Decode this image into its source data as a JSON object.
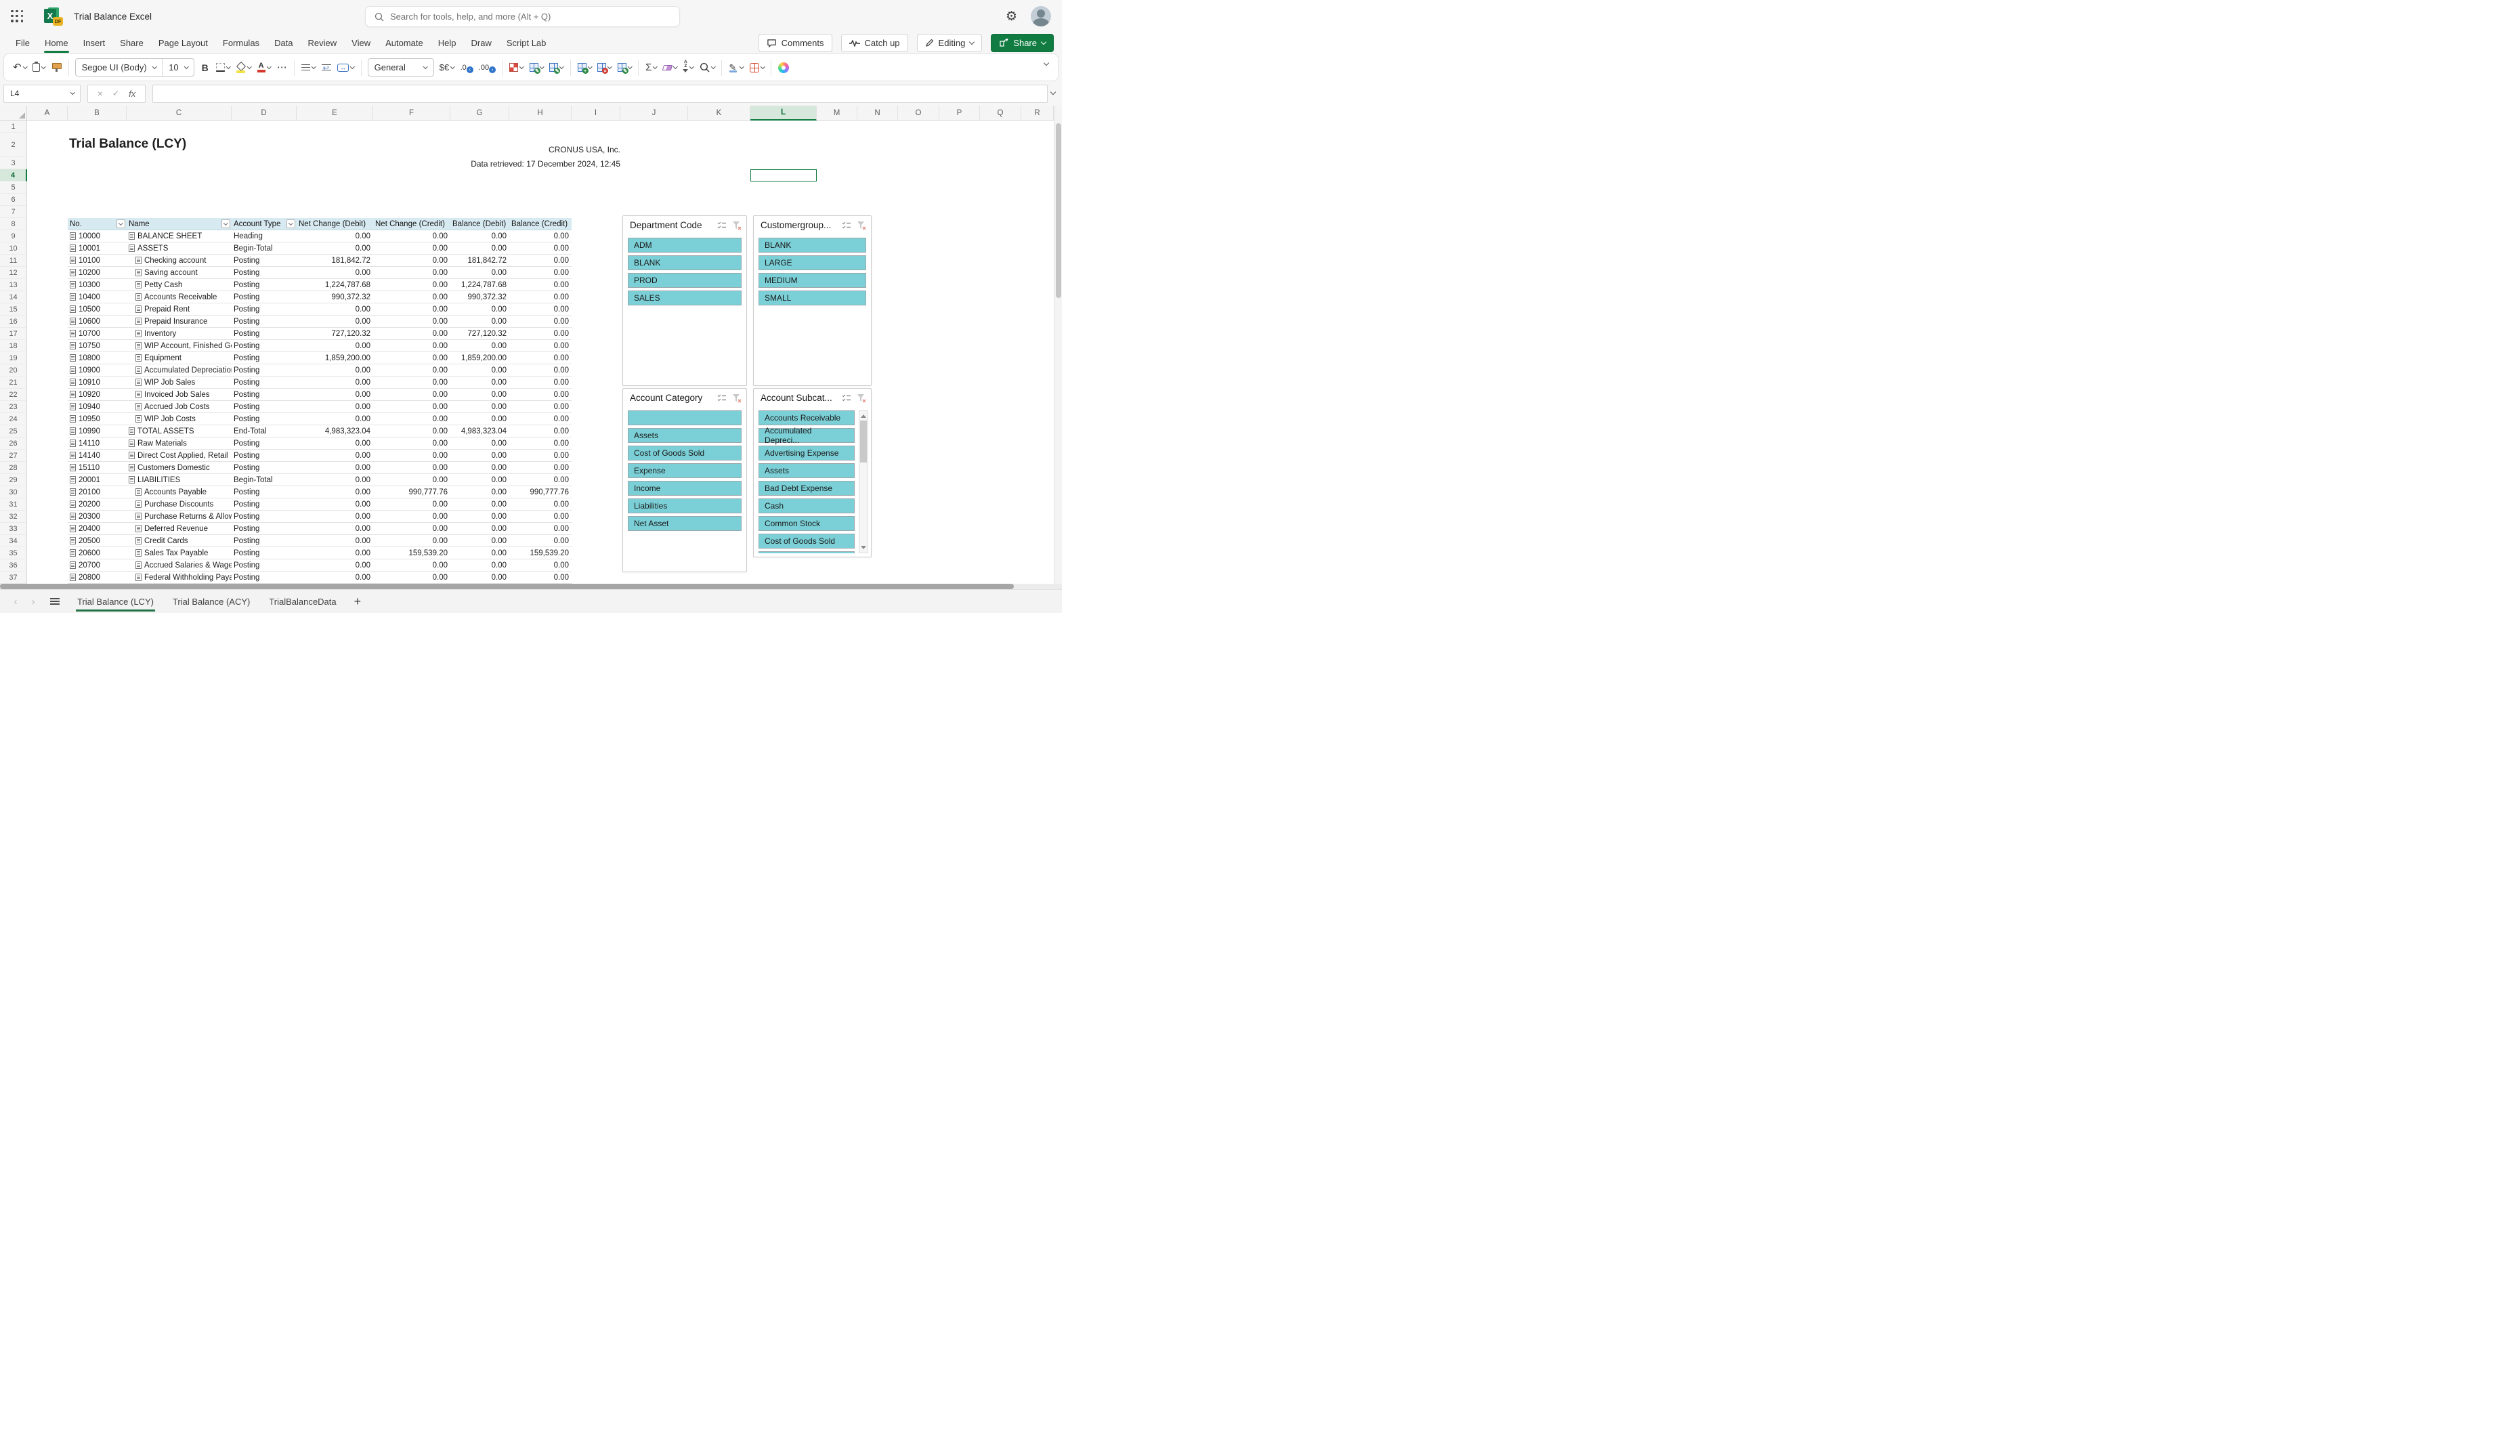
{
  "app": {
    "title": "Trial Balance Excel",
    "search_placeholder": "Search for tools, help, and more (Alt + Q)"
  },
  "ribbon": {
    "tabs": [
      "File",
      "Home",
      "Insert",
      "Share",
      "Page Layout",
      "Formulas",
      "Data",
      "Review",
      "View",
      "Automate",
      "Help",
      "Draw",
      "Script Lab"
    ],
    "active_tab": "Home",
    "comments_label": "Comments",
    "catch_up_label": "Catch up",
    "editing_label": "Editing",
    "share_label": "Share"
  },
  "toolbar": {
    "font_name": "Segoe UI (Body)",
    "font_size": "10",
    "bold_label": "B",
    "number_format": "General",
    "currency_label": "$€",
    "decrease_decimal_label": ".0",
    "increase_decimal_label": ".00",
    "autosum_label": "Σ",
    "sort_label": "AZ"
  },
  "formula_bar": {
    "name_box": "L4",
    "cancel_glyph": "×",
    "enter_glyph": "✓",
    "fx_label": "fx"
  },
  "grid": {
    "columns": [
      "A",
      "B",
      "C",
      "D",
      "E",
      "F",
      "G",
      "H",
      "I",
      "J",
      "K",
      "L",
      "M",
      "N",
      "O",
      "P",
      "Q",
      "R"
    ],
    "selected_column": "L",
    "row_count": 37,
    "selected_row": 4,
    "active_cell": "L4"
  },
  "sheet": {
    "title": "Trial Balance (LCY)",
    "company": "CRONUS USA, Inc.",
    "retrieved": "Data retrieved: 17 December 2024, 12:45",
    "table": {
      "headers": [
        "No.",
        "Name",
        "Account Type",
        "Net Change (Debit)",
        "Net Change (Credit)",
        "Balance (Debit)",
        "Balance (Credit)"
      ],
      "rows": [
        {
          "no": "10000",
          "name": "BALANCE SHEET",
          "type": "Heading",
          "ncd": "0.00",
          "ncc": "0.00",
          "bd": "0.00",
          "bc": "0.00",
          "indent": false
        },
        {
          "no": "10001",
          "name": "ASSETS",
          "type": "Begin-Total",
          "ncd": "0.00",
          "ncc": "0.00",
          "bd": "0.00",
          "bc": "0.00",
          "indent": false
        },
        {
          "no": "10100",
          "name": "Checking account",
          "type": "Posting",
          "ncd": "181,842.72",
          "ncc": "0.00",
          "bd": "181,842.72",
          "bc": "0.00",
          "indent": true
        },
        {
          "no": "10200",
          "name": "Saving account",
          "type": "Posting",
          "ncd": "0.00",
          "ncc": "0.00",
          "bd": "0.00",
          "bc": "0.00",
          "indent": true
        },
        {
          "no": "10300",
          "name": "Petty Cash",
          "type": "Posting",
          "ncd": "1,224,787.68",
          "ncc": "0.00",
          "bd": "1,224,787.68",
          "bc": "0.00",
          "indent": true
        },
        {
          "no": "10400",
          "name": "Accounts Receivable",
          "type": "Posting",
          "ncd": "990,372.32",
          "ncc": "0.00",
          "bd": "990,372.32",
          "bc": "0.00",
          "indent": true
        },
        {
          "no": "10500",
          "name": "Prepaid Rent",
          "type": "Posting",
          "ncd": "0.00",
          "ncc": "0.00",
          "bd": "0.00",
          "bc": "0.00",
          "indent": true
        },
        {
          "no": "10600",
          "name": "Prepaid Insurance",
          "type": "Posting",
          "ncd": "0.00",
          "ncc": "0.00",
          "bd": "0.00",
          "bc": "0.00",
          "indent": true
        },
        {
          "no": "10700",
          "name": "Inventory",
          "type": "Posting",
          "ncd": "727,120.32",
          "ncc": "0.00",
          "bd": "727,120.32",
          "bc": "0.00",
          "indent": true
        },
        {
          "no": "10750",
          "name": "WIP Account, Finished Goods",
          "type": "Posting",
          "ncd": "0.00",
          "ncc": "0.00",
          "bd": "0.00",
          "bc": "0.00",
          "indent": true
        },
        {
          "no": "10800",
          "name": "Equipment",
          "type": "Posting",
          "ncd": "1,859,200.00",
          "ncc": "0.00",
          "bd": "1,859,200.00",
          "bc": "0.00",
          "indent": true
        },
        {
          "no": "10900",
          "name": "Accumulated Depreciation",
          "type": "Posting",
          "ncd": "0.00",
          "ncc": "0.00",
          "bd": "0.00",
          "bc": "0.00",
          "indent": true
        },
        {
          "no": "10910",
          "name": "WIP Job Sales",
          "type": "Posting",
          "ncd": "0.00",
          "ncc": "0.00",
          "bd": "0.00",
          "bc": "0.00",
          "indent": true
        },
        {
          "no": "10920",
          "name": "Invoiced Job Sales",
          "type": "Posting",
          "ncd": "0.00",
          "ncc": "0.00",
          "bd": "0.00",
          "bc": "0.00",
          "indent": true
        },
        {
          "no": "10940",
          "name": "Accrued Job Costs",
          "type": "Posting",
          "ncd": "0.00",
          "ncc": "0.00",
          "bd": "0.00",
          "bc": "0.00",
          "indent": true
        },
        {
          "no": "10950",
          "name": "WIP Job Costs",
          "type": "Posting",
          "ncd": "0.00",
          "ncc": "0.00",
          "bd": "0.00",
          "bc": "0.00",
          "indent": true
        },
        {
          "no": "10990",
          "name": "TOTAL ASSETS",
          "type": "End-Total",
          "ncd": "4,983,323.04",
          "ncc": "0.00",
          "bd": "4,983,323.04",
          "bc": "0.00",
          "indent": false
        },
        {
          "no": "14110",
          "name": "Raw Materials",
          "type": "Posting",
          "ncd": "0.00",
          "ncc": "0.00",
          "bd": "0.00",
          "bc": "0.00",
          "indent": false
        },
        {
          "no": "14140",
          "name": "Direct Cost Applied, Retail",
          "type": "Posting",
          "ncd": "0.00",
          "ncc": "0.00",
          "bd": "0.00",
          "bc": "0.00",
          "indent": false
        },
        {
          "no": "15110",
          "name": "Customers Domestic",
          "type": "Posting",
          "ncd": "0.00",
          "ncc": "0.00",
          "bd": "0.00",
          "bc": "0.00",
          "indent": false
        },
        {
          "no": "20001",
          "name": "LIABILITIES",
          "type": "Begin-Total",
          "ncd": "0.00",
          "ncc": "0.00",
          "bd": "0.00",
          "bc": "0.00",
          "indent": false
        },
        {
          "no": "20100",
          "name": "Accounts Payable",
          "type": "Posting",
          "ncd": "0.00",
          "ncc": "990,777.76",
          "bd": "0.00",
          "bc": "990,777.76",
          "indent": true
        },
        {
          "no": "20200",
          "name": "Purchase Discounts",
          "type": "Posting",
          "ncd": "0.00",
          "ncc": "0.00",
          "bd": "0.00",
          "bc": "0.00",
          "indent": true
        },
        {
          "no": "20300",
          "name": "Purchase Returns & Allowances",
          "type": "Posting",
          "ncd": "0.00",
          "ncc": "0.00",
          "bd": "0.00",
          "bc": "0.00",
          "indent": true
        },
        {
          "no": "20400",
          "name": "Deferred Revenue",
          "type": "Posting",
          "ncd": "0.00",
          "ncc": "0.00",
          "bd": "0.00",
          "bc": "0.00",
          "indent": true
        },
        {
          "no": "20500",
          "name": "Credit Cards",
          "type": "Posting",
          "ncd": "0.00",
          "ncc": "0.00",
          "bd": "0.00",
          "bc": "0.00",
          "indent": true
        },
        {
          "no": "20600",
          "name": "Sales Tax Payable",
          "type": "Posting",
          "ncd": "0.00",
          "ncc": "159,539.20",
          "bd": "0.00",
          "bc": "159,539.20",
          "indent": true
        },
        {
          "no": "20700",
          "name": "Accrued Salaries & Wages",
          "type": "Posting",
          "ncd": "0.00",
          "ncc": "0.00",
          "bd": "0.00",
          "bc": "0.00",
          "indent": true
        },
        {
          "no": "20800",
          "name": "Federal Withholding Payable",
          "type": "Posting",
          "ncd": "0.00",
          "ncc": "0.00",
          "bd": "0.00",
          "bc": "0.00",
          "indent": true
        }
      ]
    }
  },
  "slicers": [
    {
      "title": "Department Code",
      "items": [
        "ADM",
        "BLANK",
        "PROD",
        "SALES"
      ],
      "scrollbar": false
    },
    {
      "title": "Customergroup...",
      "items": [
        "BLANK",
        "LARGE",
        "MEDIUM",
        "SMALL"
      ],
      "scrollbar": false
    },
    {
      "title": "Account Category",
      "items": [
        "",
        "Assets",
        "Cost of Goods Sold",
        "Expense",
        "Income",
        "Liabilities",
        "Net Asset"
      ],
      "scrollbar": false
    },
    {
      "title": "Account Subcat...",
      "items": [
        "Accounts Receivable",
        "Accumulated Depreci...",
        "Advertising Expense",
        "Assets",
        "Bad Debt Expense",
        "Cash",
        "Common Stock",
        "Cost of Goods Sold"
      ],
      "scrollbar": true
    }
  ],
  "sheet_tabs": {
    "tabs": [
      "Trial Balance (LCY)",
      "Trial Balance (ACY)",
      "TrialBalanceData"
    ],
    "active": "Trial Balance (LCY)",
    "add_label": "+"
  },
  "colors": {
    "excel_green": "#107c41",
    "selection_green": "#d5e8db",
    "table_header_blue": "#d8eaf1",
    "slicer_teal": "#7bcfd6"
  }
}
